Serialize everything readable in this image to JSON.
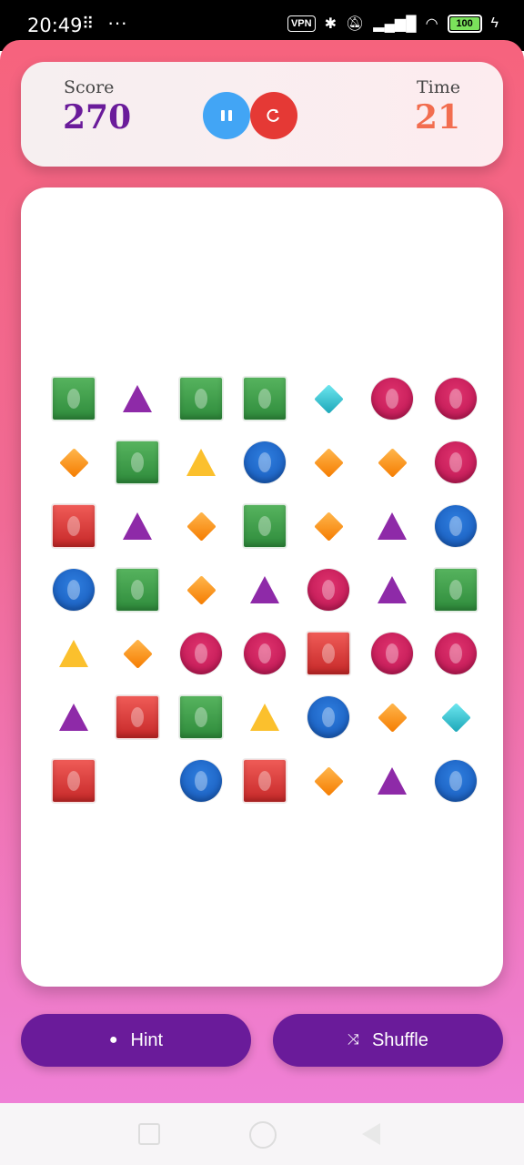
{
  "status_bar": {
    "time": "20:49",
    "vpn_label": "VPN",
    "battery": "100"
  },
  "header": {
    "score_label": "Score",
    "score_value": "270",
    "time_label": "Time",
    "time_value": "21",
    "pause_icon": "pause-icon",
    "restart_icon": "restart-icon"
  },
  "board": {
    "rows": [
      [
        "sq-green",
        "t-purple",
        "sq-green",
        "sq-green",
        "d-teal",
        "c-pink",
        "c-pink"
      ],
      [
        "d-orange",
        "sq-green",
        "t-yellow",
        "c-blue",
        "d-orange",
        "d-orange",
        "c-pink"
      ],
      [
        "sq-red",
        "t-purple",
        "d-orange",
        "sq-green",
        "d-orange",
        "t-purple",
        "c-blue"
      ],
      [
        "c-blue",
        "sq-green",
        "d-orange",
        "t-purple",
        "c-pink",
        "t-purple",
        "sq-green"
      ],
      [
        "t-yellow",
        "d-orange",
        "c-pink",
        "c-pink",
        "sq-red",
        "c-pink",
        "c-pink"
      ],
      [
        "t-purple",
        "sq-red",
        "sq-green",
        "t-yellow",
        "c-blue",
        "d-orange",
        "d-teal"
      ],
      [
        "sq-red",
        "",
        "c-blue",
        "sq-red",
        "d-orange",
        "t-purple",
        "c-blue"
      ]
    ]
  },
  "actions": {
    "hint_label": "Hint",
    "hint_icon": "lightbulb-icon",
    "shuffle_label": "Shuffle",
    "shuffle_icon": "shuffle-icon"
  },
  "colors": {
    "accent": "#6a1b9a",
    "time": "#f26d4f",
    "pause": "#42a5f5",
    "restart": "#e53935"
  }
}
